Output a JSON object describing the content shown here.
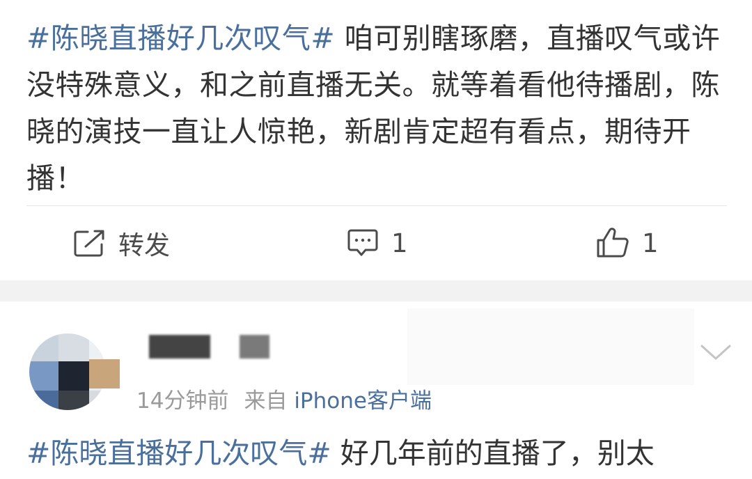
{
  "post": {
    "hashtag": "#陈晓直播好几次叹气#",
    "body": " 咱可别瞎琢磨，直播叹气或许没特殊意义，和之前直播无关。就等着看他待播剧，陈晓的演技一直让人惊艳，新剧肯定超有看点，期待开播！",
    "actions": {
      "repost": {
        "icon": "share-square-icon",
        "label": "转发"
      },
      "comment": {
        "icon": "comment-icon",
        "count": "1"
      },
      "like": {
        "icon": "thumbs-up-icon",
        "count": "1"
      }
    }
  },
  "comment": {
    "time": "14分钟前",
    "source_prefix": "来自",
    "device": "iPhone客户端",
    "hashtag": "#陈晓直播好几次叹气#",
    "body": " 好几年前的直播了，别太"
  },
  "colors": {
    "link": "#4a6f9c",
    "text": "#333333",
    "meta": "#9a9a9a",
    "separator": "#f2f2f2"
  }
}
